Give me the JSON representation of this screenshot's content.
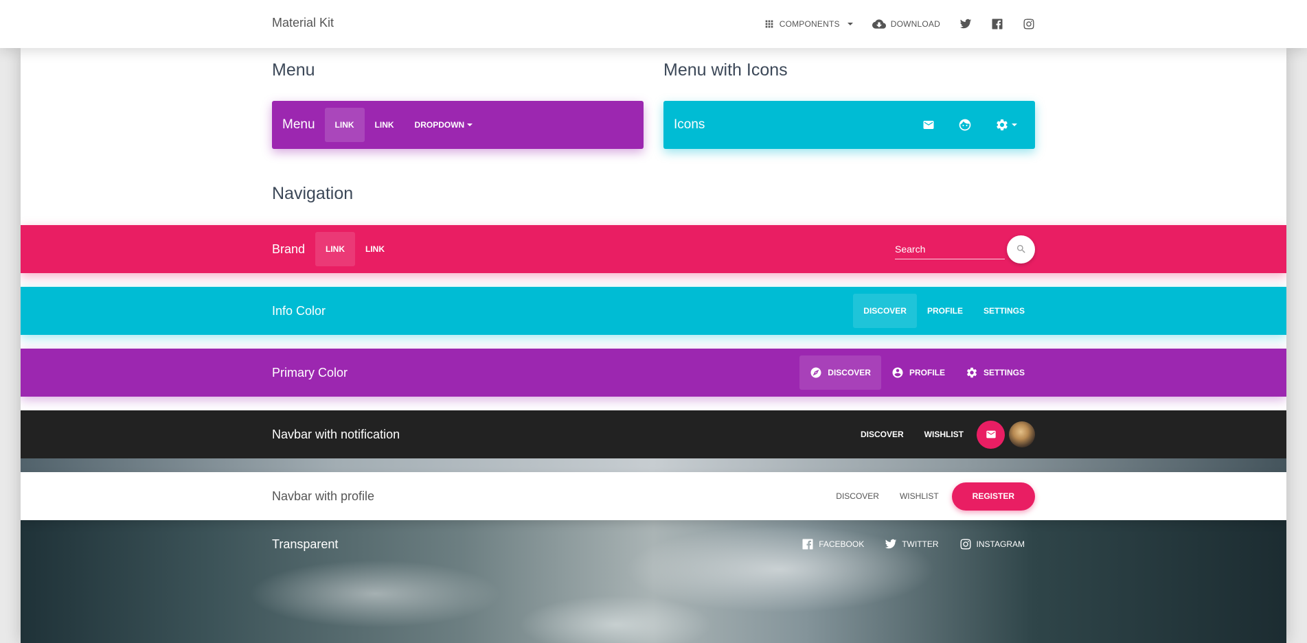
{
  "topbar": {
    "brand": "Material Kit",
    "items": [
      {
        "label": "Components",
        "icon": "apps-icon"
      },
      {
        "label": "Download",
        "icon": "cloud-download-icon"
      }
    ],
    "social": [
      "twitter-icon",
      "facebook-icon",
      "instagram-icon"
    ]
  },
  "sections": {
    "menu_title": "Menu",
    "menu_icons_title": "Menu with Icons",
    "navigation_title": "Navigation"
  },
  "menu": {
    "brand": "Menu",
    "links": [
      "Link",
      "Link"
    ],
    "dropdown": "Dropdown"
  },
  "menu_icons": {
    "brand": "Icons",
    "icons": [
      "mail-icon",
      "face-icon",
      "settings-icon"
    ]
  },
  "rose_nav": {
    "brand": "Brand",
    "links": [
      "Link",
      "Link"
    ],
    "search_placeholder": "Search"
  },
  "info_nav": {
    "brand": "Info Color",
    "links": [
      "Discover",
      "Profile",
      "Settings"
    ]
  },
  "primary_nav": {
    "brand": "Primary Color",
    "links": [
      "Discover",
      "Profile",
      "Settings"
    ]
  },
  "notification_nav": {
    "brand": "Navbar with notification",
    "links": [
      "Discover",
      "Wishlist"
    ]
  },
  "profile_nav": {
    "brand": "Navbar with profile",
    "links": [
      "Discover",
      "Wishlist"
    ],
    "button": "Register"
  },
  "transparent_nav": {
    "brand": "Transparent",
    "links": [
      "Facebook",
      "Twitter",
      "Instagram"
    ]
  },
  "colors": {
    "primary": "#9c27b0",
    "info": "#00bcd4",
    "rose": "#e91e63",
    "dark": "#222222"
  }
}
